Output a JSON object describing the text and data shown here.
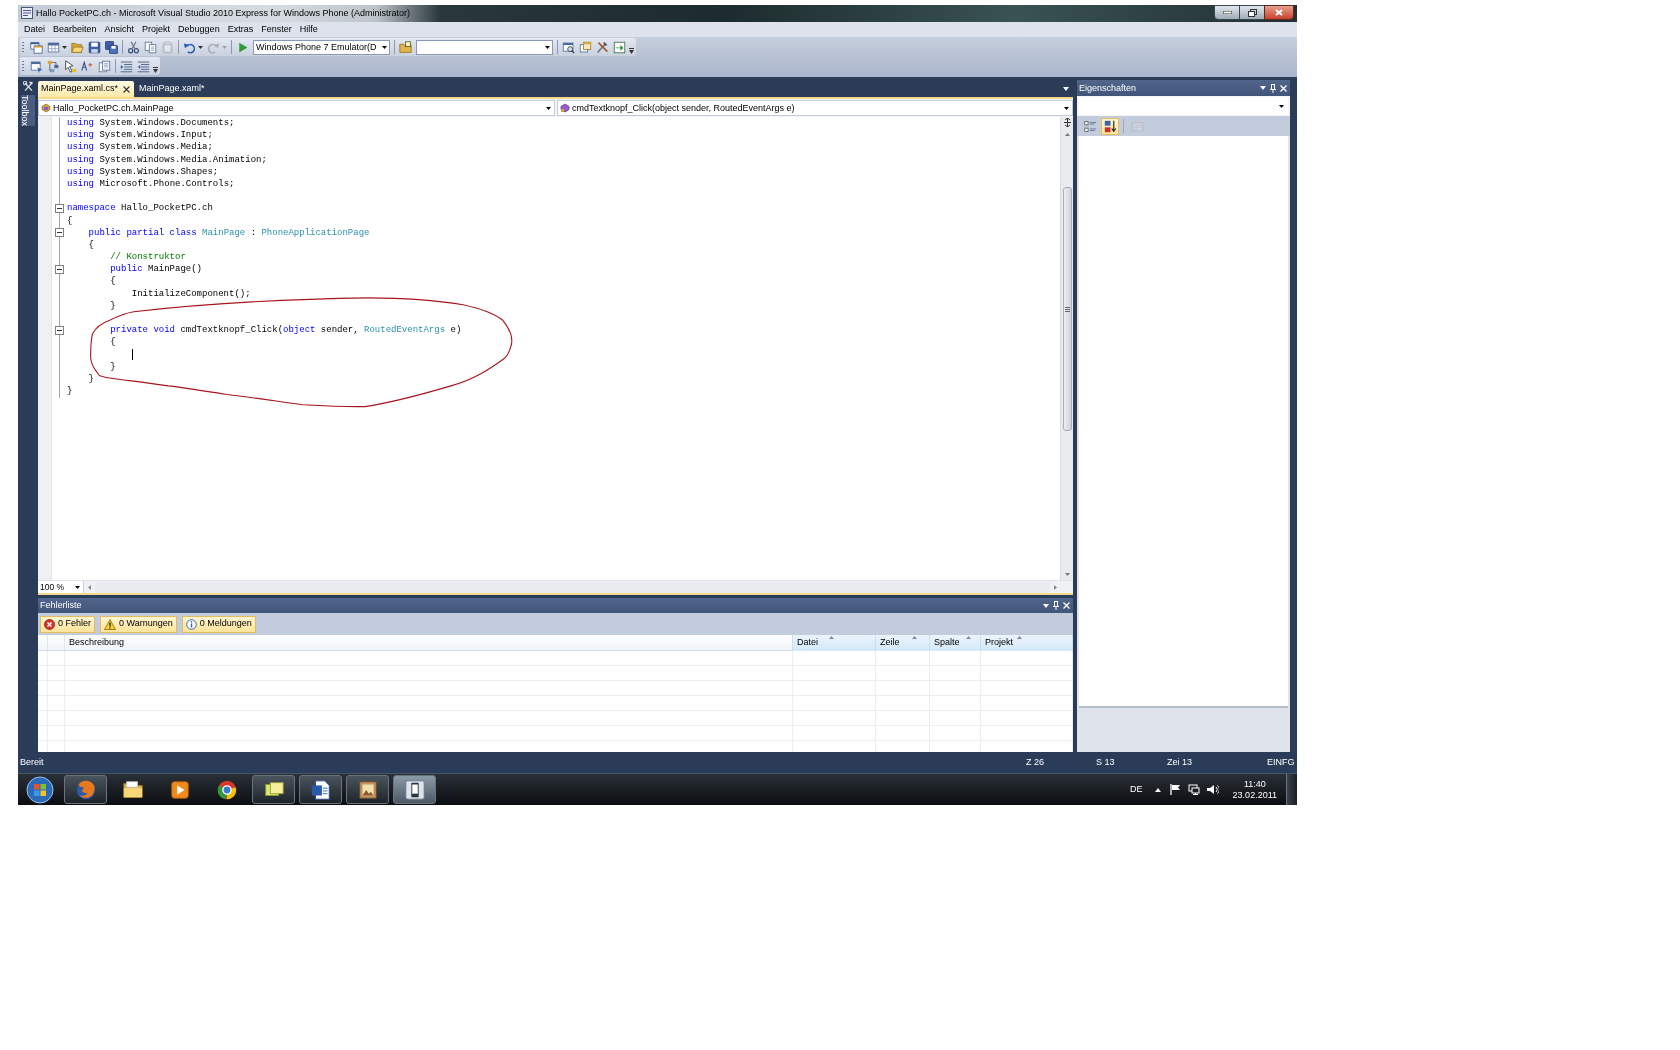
{
  "window": {
    "title": "Hallo PocketPC.ch - Microsoft Visual Studio 2010 Express for Windows Phone (Administrator)"
  },
  "menu": [
    {
      "label": "Datei"
    },
    {
      "label": "Bearbeiten"
    },
    {
      "label": "Ansicht"
    },
    {
      "label": "Projekt"
    },
    {
      "label": "Debuggen"
    },
    {
      "label": "Extras"
    },
    {
      "label": "Fenster"
    },
    {
      "label": "Hilfe"
    }
  ],
  "toolbars": [
    {
      "items": [
        {
          "kind": "button",
          "disabled": false
        },
        {
          "kind": "split",
          "disabled": false
        },
        {
          "kind": "button",
          "disabled": false
        },
        {
          "kind": "button",
          "disabled": false
        },
        {
          "kind": "button",
          "disabled": false
        },
        {
          "kind": "separator"
        },
        {
          "kind": "button",
          "disabled": false
        },
        {
          "kind": "button",
          "disabled": false
        },
        {
          "kind": "button",
          "disabled": true
        },
        {
          "kind": "separator"
        },
        {
          "kind": "split",
          "disabled": false
        },
        {
          "kind": "split",
          "disabled": true
        },
        {
          "kind": "separator"
        },
        {
          "kind": "button",
          "disabled": false
        },
        {
          "kind": "combo",
          "value": "Windows Phone 7 Emulator(D"
        },
        {
          "kind": "separator"
        },
        {
          "kind": "button",
          "disabled": false
        },
        {
          "kind": "combo"
        },
        {
          "kind": "separator"
        },
        {
          "kind": "button",
          "disabled": false
        },
        {
          "kind": "button",
          "disabled": false
        },
        {
          "kind": "button",
          "disabled": false
        },
        {
          "kind": "button",
          "disabled": false
        },
        {
          "kind": "overflow"
        }
      ]
    },
    {
      "items": [
        {
          "kind": "button",
          "disabled": false
        },
        {
          "kind": "button",
          "disabled": false
        },
        {
          "kind": "button",
          "disabled": false
        },
        {
          "kind": "button",
          "disabled": false
        },
        {
          "kind": "button",
          "disabled": false
        },
        {
          "kind": "separator"
        },
        {
          "kind": "button",
          "disabled": false
        },
        {
          "kind": "button",
          "disabled": false
        },
        {
          "kind": "overflow"
        }
      ]
    }
  ],
  "toolbox": {
    "label": "Toolbox"
  },
  "document_tabs": [
    {
      "label": "MainPage.xaml.cs*",
      "selected": true
    },
    {
      "label": "MainPage.xaml*",
      "selected": false
    }
  ],
  "navigation": {
    "type": "Hallo_PocketPC.ch.MainPage",
    "member": "cmdTextknopf_Click(object sender, RoutedEventArgs e)"
  },
  "editor": {
    "lines": [
      {
        "kind": "code",
        "fold_marker": false,
        "tokens": [
          {
            "kind": "keyword",
            "text": "using"
          },
          {
            "kind": "plain",
            "text": " System.Windows.Documents;"
          }
        ]
      },
      {
        "kind": "code",
        "fold_marker": false,
        "tokens": [
          {
            "kind": "keyword",
            "text": "using"
          },
          {
            "kind": "plain",
            "text": " System.Windows.Input;"
          }
        ]
      },
      {
        "kind": "code",
        "fold_marker": false,
        "tokens": [
          {
            "kind": "keyword",
            "text": "using"
          },
          {
            "kind": "plain",
            "text": " System.Windows.Media;"
          }
        ]
      },
      {
        "kind": "code",
        "fold_marker": false,
        "tokens": [
          {
            "kind": "keyword",
            "text": "using"
          },
          {
            "kind": "plain",
            "text": " System.Windows.Media.Animation;"
          }
        ]
      },
      {
        "kind": "code",
        "fold_marker": false,
        "tokens": [
          {
            "kind": "keyword",
            "text": "using"
          },
          {
            "kind": "plain",
            "text": " System.Windows.Shapes;"
          }
        ]
      },
      {
        "kind": "code",
        "fold_marker": false,
        "tokens": [
          {
            "kind": "keyword",
            "text": "using"
          },
          {
            "kind": "plain",
            "text": " Microsoft.Phone.Controls;"
          }
        ]
      },
      {
        "kind": "blank",
        "caret": false
      },
      {
        "kind": "code",
        "fold_marker": true,
        "tokens": [
          {
            "kind": "keyword",
            "text": "namespace"
          },
          {
            "kind": "plain",
            "text": " Hallo_PocketPC.ch"
          }
        ]
      },
      {
        "kind": "code",
        "fold_marker": false,
        "tokens": [
          {
            "kind": "plain",
            "text": "{"
          }
        ]
      },
      {
        "kind": "code",
        "fold_marker": true,
        "tokens": [
          {
            "kind": "keyword",
            "text": "    public partial class"
          },
          {
            "kind": "type",
            "text": " MainPage"
          },
          {
            "kind": "plain",
            "text": " : "
          },
          {
            "kind": "type",
            "text": "PhoneApplicationPage"
          }
        ]
      },
      {
        "kind": "code",
        "fold_marker": false,
        "tokens": [
          {
            "kind": "plain",
            "text": "    {"
          }
        ]
      },
      {
        "kind": "code",
        "fold_marker": false,
        "tokens": [
          {
            "kind": "comment",
            "text": "        // Konstruktor"
          }
        ]
      },
      {
        "kind": "code",
        "fold_marker": true,
        "tokens": [
          {
            "kind": "keyword",
            "text": "        public"
          },
          {
            "kind": "plain",
            "text": " MainPage()"
          }
        ]
      },
      {
        "kind": "code",
        "fold_marker": false,
        "tokens": [
          {
            "kind": "plain",
            "text": "        {"
          }
        ]
      },
      {
        "kind": "code",
        "fold_marker": false,
        "tokens": [
          {
            "kind": "plain",
            "text": "            InitializeComponent();"
          }
        ]
      },
      {
        "kind": "code",
        "fold_marker": false,
        "tokens": [
          {
            "kind": "plain",
            "text": "        }"
          }
        ]
      },
      {
        "kind": "blank",
        "caret": false
      },
      {
        "kind": "code",
        "fold_marker": true,
        "tokens": [
          {
            "kind": "keyword",
            "text": "        private void"
          },
          {
            "kind": "plain",
            "text": " cmdTextknopf_Click("
          },
          {
            "kind": "keyword",
            "text": "object"
          },
          {
            "kind": "plain",
            "text": " sender, "
          },
          {
            "kind": "type",
            "text": "RoutedEventArgs"
          },
          {
            "kind": "plain",
            "text": " e)"
          }
        ]
      },
      {
        "kind": "code",
        "fold_marker": false,
        "tokens": [
          {
            "kind": "plain",
            "text": "        {"
          }
        ]
      },
      {
        "kind": "blank",
        "caret": true
      },
      {
        "kind": "code",
        "fold_marker": false,
        "tokens": [
          {
            "kind": "plain",
            "text": "        }"
          }
        ]
      },
      {
        "kind": "code",
        "fold_marker": false,
        "tokens": [
          {
            "kind": "plain",
            "text": "    }"
          }
        ]
      },
      {
        "kind": "code",
        "fold_marker": false,
        "tokens": [
          {
            "kind": "plain",
            "text": "}"
          }
        ]
      }
    ],
    "zoom": "100 %"
  },
  "error_list": {
    "title": "Fehlerliste",
    "filters": [
      {
        "kind": "error",
        "label": "0 Fehler",
        "on": true
      },
      {
        "kind": "warning",
        "label": "0 Warnungen",
        "on": true
      },
      {
        "kind": "message",
        "label": "0 Meldungen",
        "on": true
      }
    ],
    "columns": [
      {
        "label": "Beschreibung",
        "sort_indicator": false
      },
      {
        "label": "Datei",
        "sort_indicator": true
      },
      {
        "label": "Zeile",
        "sort_indicator": true
      },
      {
        "label": "Spalte",
        "sort_indicator": true
      },
      {
        "label": "Projekt",
        "sort_indicator": true
      }
    ]
  },
  "properties": {
    "title": "Eigenschaften",
    "toolbar": [
      {
        "kind": "categorized",
        "selected": false,
        "disabled": false
      },
      {
        "kind": "alphabetical",
        "selected": true,
        "disabled": false
      },
      {
        "kind": "pages",
        "selected": false,
        "disabled": true
      }
    ]
  },
  "status_bar": {
    "message": "Bereit",
    "line": "Z 26",
    "column": "S 13",
    "character": "Zei 13",
    "mode": "EINFG"
  },
  "taskbar": {
    "apps": [
      {
        "running": true,
        "selected": false
      },
      {
        "running": false,
        "selected": false
      },
      {
        "running": false,
        "selected": false
      },
      {
        "running": false,
        "selected": false
      },
      {
        "running": true,
        "selected": false
      },
      {
        "running": true,
        "selected": false
      },
      {
        "running": true,
        "selected": false
      },
      {
        "running": true,
        "selected": true
      }
    ],
    "language": "DE",
    "time": "11:40",
    "date": "23.02.2011"
  }
}
